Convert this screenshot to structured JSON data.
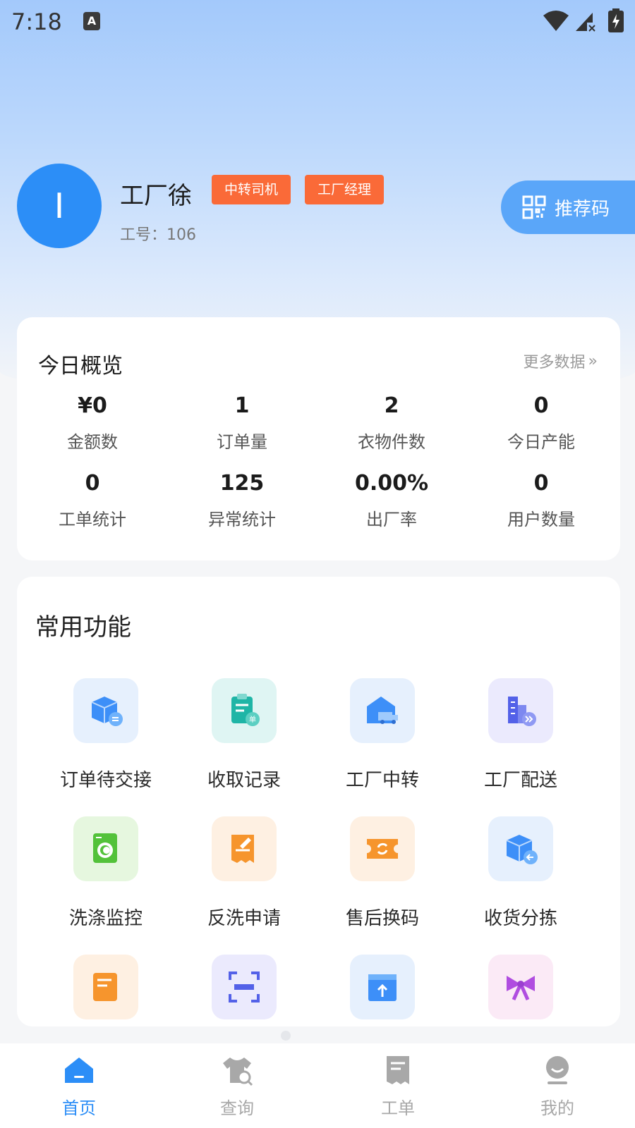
{
  "status_bar": {
    "time": "7:18",
    "notification_letter": "A"
  },
  "profile": {
    "avatar_letter": "I",
    "name": "工厂徐",
    "roles": [
      "中转司机",
      "工厂经理"
    ],
    "employee_no": "工号：106",
    "referral_button": "推荐码"
  },
  "overview": {
    "title": "今日概览",
    "more_link": "更多数据",
    "more_arrow": "»",
    "stats": [
      {
        "value": "¥0",
        "label": "金额数"
      },
      {
        "value": "1",
        "label": "订单量"
      },
      {
        "value": "2",
        "label": "衣物件数"
      },
      {
        "value": "0",
        "label": "今日产能"
      },
      {
        "value": "0",
        "label": "工单统计"
      },
      {
        "value": "125",
        "label": "异常统计"
      },
      {
        "value": "0.00%",
        "label": "出厂率"
      },
      {
        "value": "0",
        "label": "用户数量"
      }
    ]
  },
  "functions": {
    "title": "常用功能",
    "items": [
      {
        "label": "订单待交接",
        "icon": "package-transfer-icon"
      },
      {
        "label": "收取记录",
        "icon": "clipboard-order-icon"
      },
      {
        "label": "工厂中转",
        "icon": "warehouse-truck-icon"
      },
      {
        "label": "工厂配送",
        "icon": "building-delivery-icon"
      },
      {
        "label": "洗涤监控",
        "icon": "washing-machine-icon"
      },
      {
        "label": "反洗申请",
        "icon": "receipt-edit-icon"
      },
      {
        "label": "售后换码",
        "icon": "ticket-exchange-icon"
      },
      {
        "label": "收货分拣",
        "icon": "package-receive-icon"
      },
      {
        "label": "",
        "icon": "document-forward-icon"
      },
      {
        "label": "",
        "icon": "scan-icon"
      },
      {
        "label": "",
        "icon": "box-upload-icon"
      },
      {
        "label": "",
        "icon": "bow-icon"
      }
    ]
  },
  "bottom_nav": [
    {
      "label": "首页",
      "icon": "home-icon",
      "active": true
    },
    {
      "label": "查询",
      "icon": "shirt-search-icon",
      "active": false
    },
    {
      "label": "工单",
      "icon": "receipt-icon",
      "active": false
    },
    {
      "label": "我的",
      "icon": "user-face-icon",
      "active": false
    }
  ],
  "colors": {
    "primary": "#2c8ef7",
    "badge": "#fa6a38",
    "referral": "#5aa6f9"
  }
}
